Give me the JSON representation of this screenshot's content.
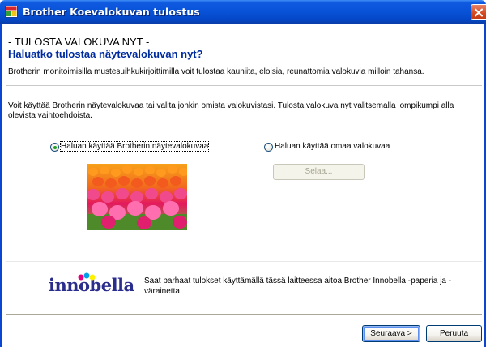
{
  "window": {
    "title": "Brother Koevalokuvan tulostus",
    "icons": {
      "app": "brother-app-icon",
      "close": "close-icon"
    }
  },
  "header": {
    "heading": "- TULOSTA VALOKUVA NYT -",
    "question": "Haluatko tulostaa näytevalokuvan nyt?",
    "description": "Brotherin monitoimisilla mustesuihkukirjoittimilla voit tulostaa kauniita, eloisia, reunattomia valokuvia milloin tahansa."
  },
  "content": {
    "instruction": "Voit käyttää Brotherin näytevalokuvaa tai valita jonkin omista valokuvistasi. Tulosta valokuva nyt valitsemalla jompikumpi alla olevista vaihtoehdoista.",
    "options": [
      {
        "label": "Haluan käyttää Brotherin näytevalokuvaa",
        "selected": true
      },
      {
        "label": "Haluan käyttää omaa valokuvaa",
        "selected": false
      }
    ],
    "browse_label": "Selaa...",
    "sample_photo": "tulip-field-photo"
  },
  "footer": {
    "logo_text": "innobella",
    "logo_colors": [
      "#e4007f",
      "#00a0e9",
      "#fff100"
    ],
    "note": "Saat parhaat tulokset käyttämällä tässä laitteessa aitoa Brother Innobella -paperia ja -värainetta."
  },
  "buttons": {
    "next_label": "Seuraava >",
    "cancel_label": "Peruuta"
  },
  "colors": {
    "titlebar": "#0852d8",
    "heading_blue": "#002ca0",
    "radio_check": "#21a121"
  }
}
